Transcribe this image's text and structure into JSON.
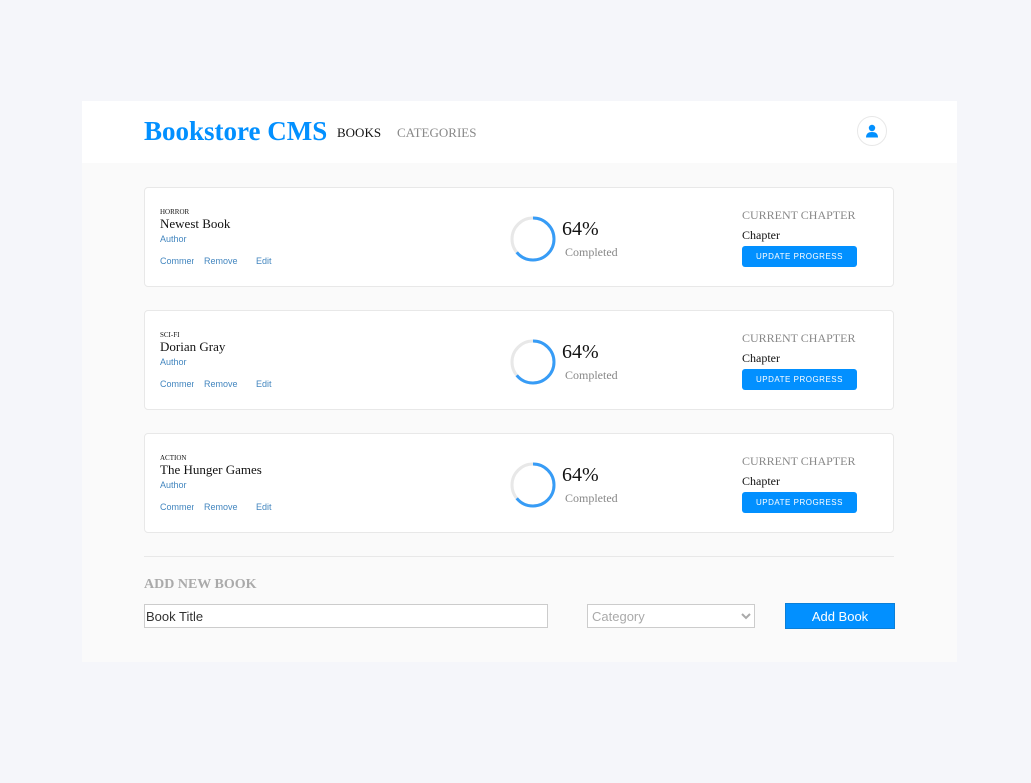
{
  "header": {
    "brand": "Bookstore CMS",
    "nav": [
      {
        "label": "BOOKS"
      },
      {
        "label": "CATEGORIES"
      }
    ],
    "user_icon": "user-icon"
  },
  "books": [
    {
      "genre": "HORROR",
      "title": "Newest Book",
      "author": "Author",
      "actions": {
        "comments": "Comments",
        "remove": "Remove",
        "edit": "Edit"
      },
      "progress": 64,
      "progress_text": "64%",
      "completed_label": "Completed",
      "chapter_label": "CURRENT CHAPTER",
      "chapter": "Chapter",
      "update_label": "UPDATE PROGRESS"
    },
    {
      "genre": "SCI-FI",
      "title": "Dorian Gray",
      "author": "Author",
      "actions": {
        "comments": "Comments",
        "remove": "Remove",
        "edit": "Edit"
      },
      "progress": 64,
      "progress_text": "64%",
      "completed_label": "Completed",
      "chapter_label": "CURRENT CHAPTER",
      "chapter": "Chapter",
      "update_label": "UPDATE PROGRESS"
    },
    {
      "genre": "ACTION",
      "title": "The Hunger Games",
      "author": "Author",
      "actions": {
        "comments": "Comments",
        "remove": "Remove",
        "edit": "Edit"
      },
      "progress": 64,
      "progress_text": "64%",
      "completed_label": "Completed",
      "chapter_label": "CURRENT CHAPTER",
      "chapter": "Chapter",
      "update_label": "UPDATE PROGRESS"
    }
  ],
  "add_form": {
    "heading": "ADD NEW BOOK",
    "title_placeholder": "Book Title",
    "category_placeholder": "Category",
    "submit_label": "Add Book"
  },
  "colors": {
    "accent": "#0290ff",
    "ring_track": "#e8e8e8",
    "ring_fill": "#379cf6",
    "link": "#4386bf"
  }
}
